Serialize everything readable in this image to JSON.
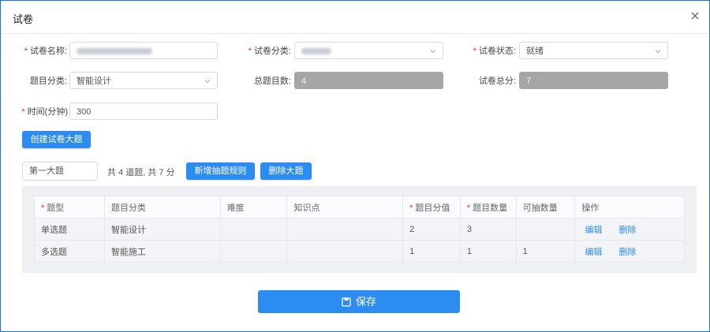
{
  "dialog": {
    "title": "试卷",
    "close_icon": "close-icon"
  },
  "form": {
    "name": {
      "label": "试卷名称:",
      "required": true
    },
    "category": {
      "label": "试卷分类:",
      "required": true
    },
    "status": {
      "label": "试卷状态:",
      "required": true,
      "value": "就绪"
    },
    "question_category": {
      "label": "题目分类:",
      "value": "智能设计"
    },
    "total_questions": {
      "label": "总题目数:",
      "value": "4"
    },
    "total_score": {
      "label": "试卷总分:",
      "value": "7"
    },
    "time": {
      "label": "时间(分钟)",
      "required": true,
      "value": "300"
    }
  },
  "buttons": {
    "create_section": "创建试卷大题",
    "add_rule": "新增抽题规则",
    "delete_section": "删除大题",
    "save": "保存"
  },
  "section": {
    "name": "第一大题",
    "summary": "共 4 道题, 共 7 分"
  },
  "table": {
    "headers": [
      {
        "text": "题型",
        "required": true
      },
      {
        "text": "题目分类",
        "required": false
      },
      {
        "text": "难度",
        "required": false
      },
      {
        "text": "知识点",
        "required": false
      },
      {
        "text": "题目分值",
        "required": true
      },
      {
        "text": "题目数量",
        "required": true
      },
      {
        "text": "可抽数量",
        "required": false
      },
      {
        "text": "操作",
        "required": false
      }
    ],
    "rows": [
      {
        "type": "单选题",
        "category": "智能设计",
        "difficulty": "",
        "knowledge": "",
        "score": "2",
        "count": "3",
        "available": "",
        "edit": "编辑",
        "delete": "删除"
      },
      {
        "type": "多选题",
        "category": "智能施工",
        "difficulty": "",
        "knowledge": "",
        "score": "1",
        "count": "1",
        "available": "1",
        "edit": "编辑",
        "delete": "删除"
      }
    ]
  },
  "colors": {
    "primary": "#2d8cf0",
    "border": "#1d74cf",
    "required": "#f5222d",
    "disabled": "#a6a6a6"
  }
}
